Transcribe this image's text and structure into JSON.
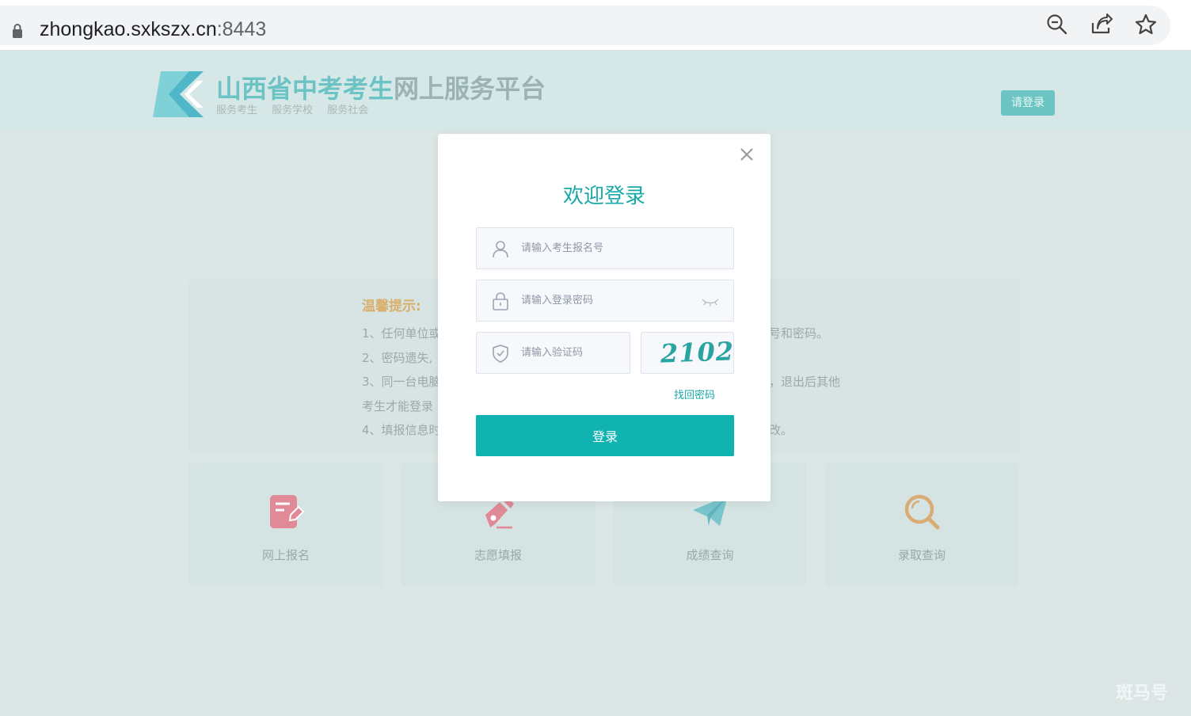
{
  "browser": {
    "url_host": "zhongkao.sxkszx.cn",
    "url_port": ":8443",
    "icons": [
      "lock-icon",
      "zoom-out-icon",
      "share-icon",
      "star-icon"
    ]
  },
  "header": {
    "title_part1": "山西省中考考生",
    "title_part2": "网上服务平台",
    "subtitle": "服务考生 服务学校 服务社会",
    "login_button": "请登录"
  },
  "tips": {
    "title": "温馨提示:",
    "lines_left": [
      "1、任何单位或",
      "2、密码遗失,",
      "3、同一台电脑",
      "考生才能登录",
      "4、填报信息时"
    ],
    "lines_right": [
      "号和密码。",
      "，退出后其他",
      "改。"
    ]
  },
  "cards": [
    {
      "label": "网上报名",
      "icon": "edit-document-icon",
      "color": "#e08a97"
    },
    {
      "label": "志愿填报",
      "icon": "pen-nib-icon",
      "color": "#e08a97"
    },
    {
      "label": "成绩查询",
      "icon": "paper-plane-icon",
      "color": "#79c5cc"
    },
    {
      "label": "录取查询",
      "icon": "magnifier-icon",
      "color": "#d9ac73"
    }
  ],
  "modal": {
    "title": "欢迎登录",
    "username_placeholder": "请输入考生报名号",
    "password_placeholder": "请输入登录密码",
    "captcha_placeholder": "请输入验证码",
    "captcha_text": "2102",
    "forgot_link": "找回密码",
    "submit_label": "登录"
  },
  "watermark": "斑马号",
  "colors": {
    "accent": "#11b3b1",
    "overlay_bg": "#dbe6e5",
    "tips_title": "#d8b06c"
  }
}
